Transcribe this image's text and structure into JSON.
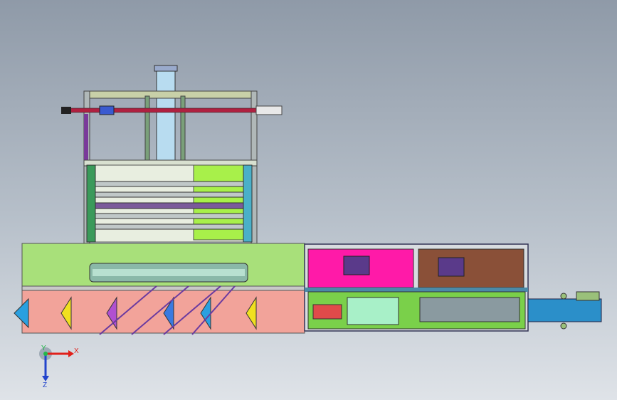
{
  "scene": {
    "background_top": "#8f9aa8",
    "background_bottom": "#dfe3e8"
  },
  "triad": {
    "x_label": "X",
    "y_label": "Y",
    "z_label": "Z",
    "x_color": "#e0201a",
    "y_color": "#22b84a",
    "z_color": "#2244cc"
  },
  "palette": {
    "base_green": "#a8e07a",
    "feed_pink": "#f2a39a",
    "magenta_panel": "#ff1aa8",
    "brown_panel": "#8a5038",
    "lime": "#6af03a",
    "conveyor_blue": "#2b8fc9",
    "frame": "#4a8aa8"
  }
}
